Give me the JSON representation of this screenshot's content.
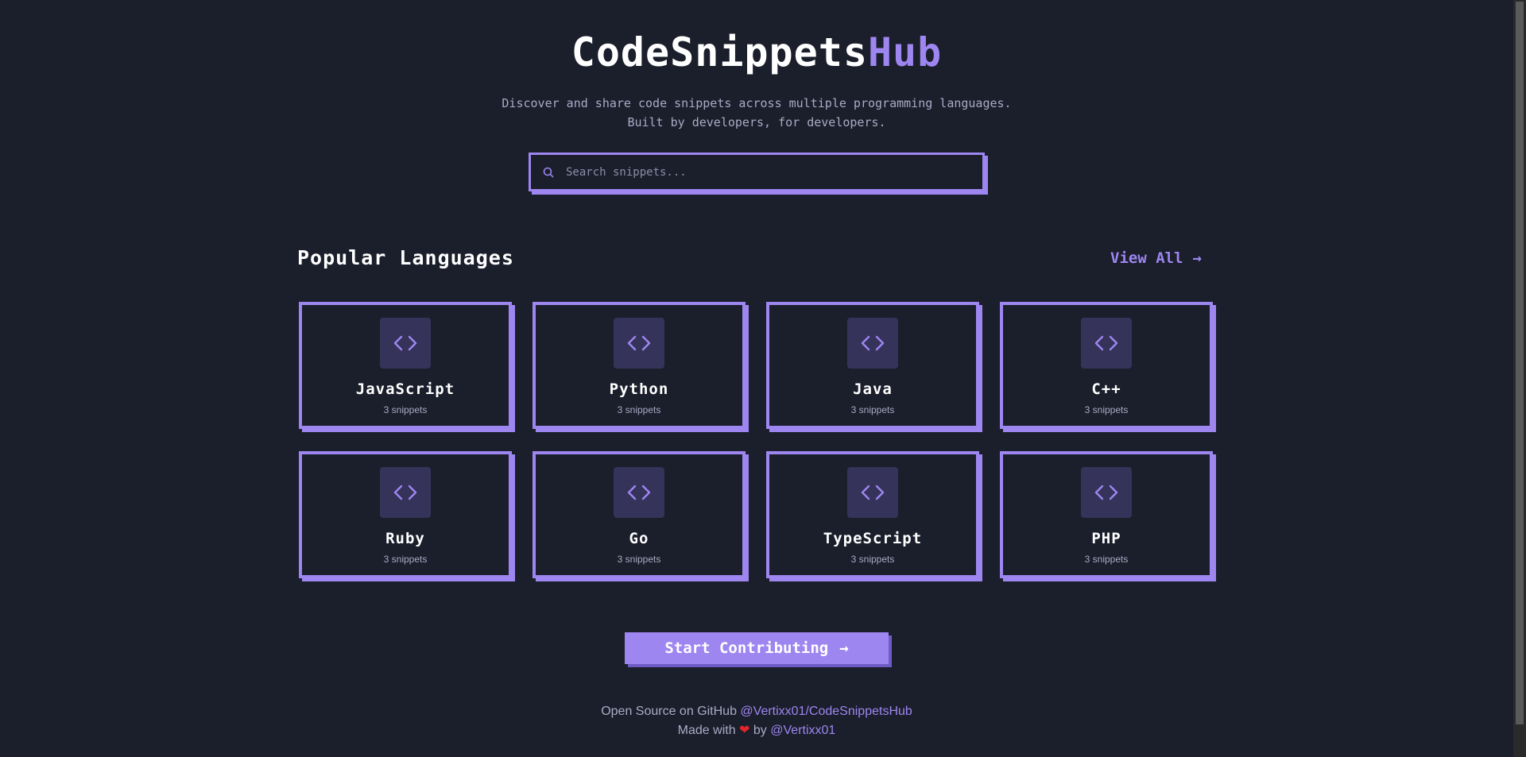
{
  "header": {
    "title_main": "CodeSnippets",
    "title_accent": "Hub",
    "subtitle_line1": "Discover and share code snippets across multiple programming languages.",
    "subtitle_line2": "Built by developers, for developers."
  },
  "search": {
    "placeholder": "Search snippets...",
    "value": ""
  },
  "languages_section": {
    "title": "Popular Languages",
    "view_all_label": "View All",
    "view_all_arrow": "→",
    "cards": [
      {
        "name": "JavaScript",
        "count": "3 snippets"
      },
      {
        "name": "Python",
        "count": "3 snippets"
      },
      {
        "name": "Java",
        "count": "3 snippets"
      },
      {
        "name": "C++",
        "count": "3 snippets"
      },
      {
        "name": "Ruby",
        "count": "3 snippets"
      },
      {
        "name": "Go",
        "count": "3 snippets"
      },
      {
        "name": "TypeScript",
        "count": "3 snippets"
      },
      {
        "name": "PHP",
        "count": "3 snippets"
      }
    ],
    "card_icon": "code-icon"
  },
  "cta": {
    "label": "Start Contributing",
    "arrow": "→"
  },
  "footer": {
    "line1_text": "Open Source on GitHub",
    "repo_link": "@Vertixx01/CodeSnippetsHub",
    "line2_prefix": "Made with",
    "heart": "❤",
    "line2_by": "by",
    "author_link": "@Vertixx01"
  },
  "colors": {
    "background": "#1b1e2b",
    "accent": "#9d86f0",
    "icon_box": "#35335a",
    "muted_text": "#a9abc4",
    "heart": "#e0262b"
  }
}
